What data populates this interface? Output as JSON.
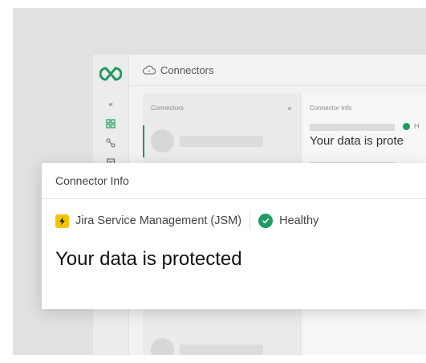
{
  "topbar": {
    "title": "Connectors"
  },
  "list_panel": {
    "heading": "Connectors"
  },
  "detail_panel": {
    "heading": "Connector Info",
    "status": "H",
    "title": "Your data is prote"
  },
  "card": {
    "heading": "Connector Info",
    "connector_name": "Jira Service Management (JSM)",
    "status": "Healthy",
    "title": "Your data is protected"
  },
  "colors": {
    "accent": "#1f9b61",
    "jira": "#f5c400"
  }
}
